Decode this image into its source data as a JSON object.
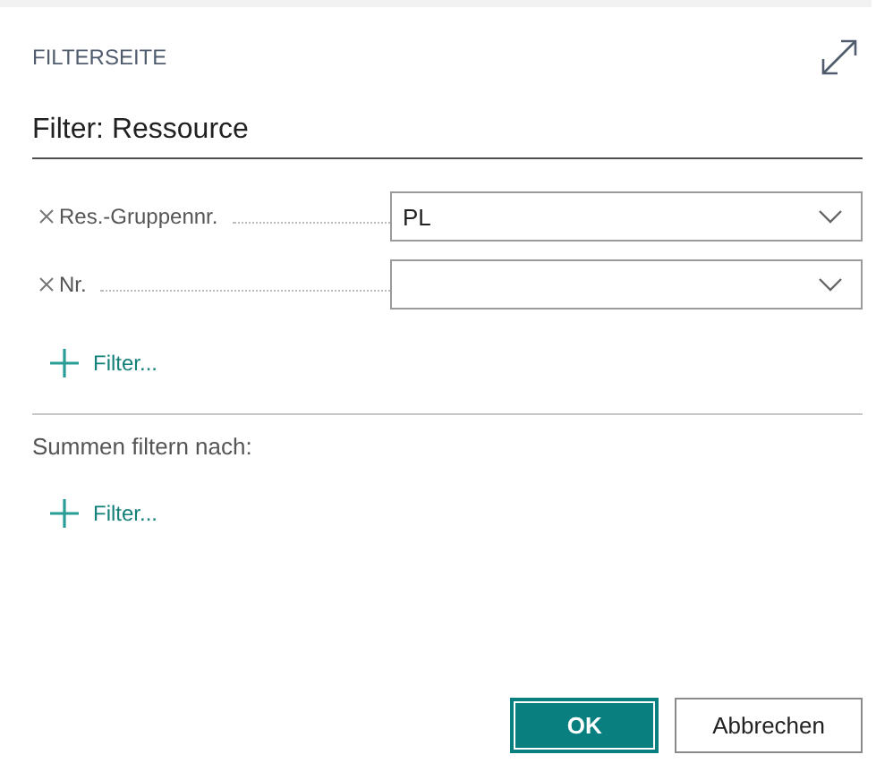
{
  "header": {
    "title": "FILTERSEITE"
  },
  "section_title": "Filter: Ressource",
  "filters": [
    {
      "label": "Res.-Gruppennr.",
      "value": "PL"
    },
    {
      "label": "Nr."
    }
  ],
  "add_filter": "Filter...",
  "totals": {
    "label": "Summen filtern nach:",
    "add_filter": "Filter..."
  },
  "buttons": [
    {
      "label": "OK",
      "kind": "primary"
    },
    {
      "label": "Abbrechen",
      "kind": "secondary"
    }
  ]
}
